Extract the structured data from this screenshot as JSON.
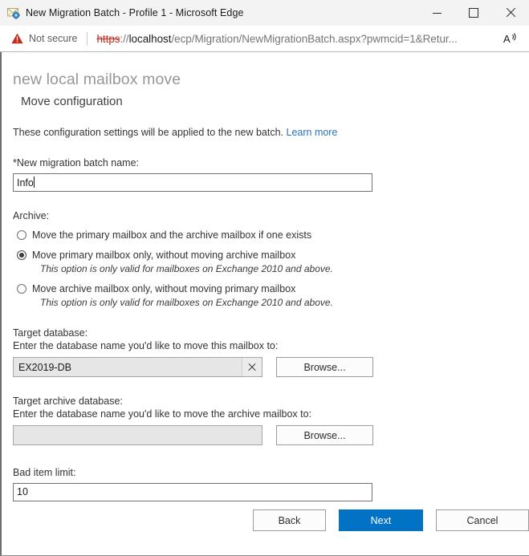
{
  "window": {
    "title": "New Migration Batch - Profile 1 - Microsoft Edge",
    "favicon_name": "exchange-mail-icon",
    "minimize_label": "Minimize",
    "maximize_label": "Maximize",
    "close_label": "Close"
  },
  "addressbar": {
    "security_icon": "warning-triangle-icon",
    "security_label": "Not secure",
    "url_scheme": "https",
    "url_separator": "://",
    "url_host": "localhost",
    "url_path": "/ecp/Migration/NewMigrationBatch.aspx?pwmcid=1&Retur...",
    "read_aloud_icon": "read-aloud-icon"
  },
  "page": {
    "title": "new local mailbox move",
    "subtitle": "Move configuration",
    "description": "These configuration settings will be applied to the new batch.",
    "learn_more": "Learn more",
    "batch_name": {
      "label": "*New migration batch name:",
      "value": "Info"
    },
    "archive": {
      "label": "Archive:",
      "options": [
        {
          "text": "Move the primary mailbox and the archive mailbox if one exists",
          "note": "",
          "checked": false
        },
        {
          "text": "Move primary mailbox only, without moving archive mailbox",
          "note": "This option is only valid for mailboxes on Exchange 2010 and above.",
          "checked": true
        },
        {
          "text": "Move archive mailbox only, without moving primary mailbox",
          "note": "This option is only valid for mailboxes on Exchange 2010 and above.",
          "checked": false
        }
      ]
    },
    "target_database": {
      "label": "Target database:",
      "hint": "Enter the database name you'd like to move this mailbox to:",
      "value": "EX2019-DB",
      "clear_icon": "clear-x-icon",
      "browse_label": "Browse..."
    },
    "target_archive_database": {
      "label": "Target archive database:",
      "hint": "Enter the database name you'd like to move the archive mailbox to:",
      "value": "",
      "browse_label": "Browse..."
    },
    "bad_item_limit": {
      "label": "Bad item limit:",
      "value": "10"
    },
    "footer": {
      "back_label": "Back",
      "next_label": "Next",
      "cancel_label": "Cancel"
    }
  },
  "colors": {
    "accent": "#0272c4",
    "link": "#2673bd",
    "warning": "#c42b1c",
    "title_gray": "#969696"
  }
}
